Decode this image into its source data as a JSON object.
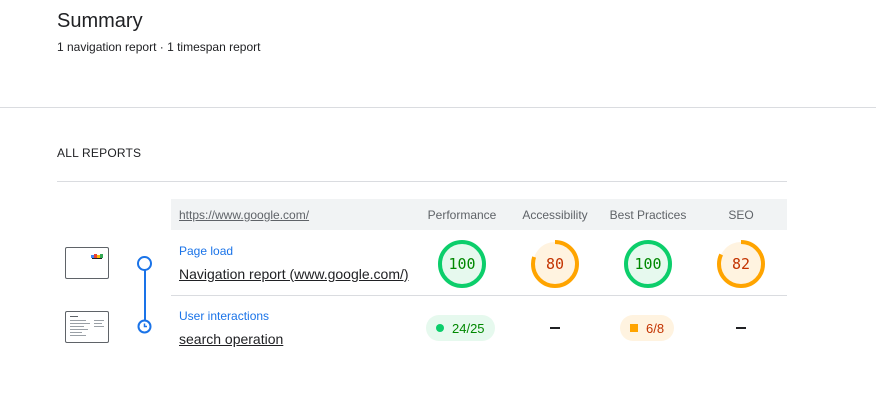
{
  "summary": {
    "title": "Summary",
    "subtitle": "1 navigation report · 1 timespan report"
  },
  "section": {
    "title": "ALL REPORTS"
  },
  "table": {
    "url": "https://www.google.com/",
    "columns": [
      "Performance",
      "Accessibility",
      "Best Practices",
      "SEO"
    ]
  },
  "rows": [
    {
      "type": "Page load",
      "name": "Navigation report (www.google.com/)",
      "scores": [
        {
          "value": "100",
          "status": "pass"
        },
        {
          "value": "80",
          "status": "average"
        },
        {
          "value": "100",
          "status": "pass"
        },
        {
          "value": "82",
          "status": "average"
        }
      ]
    },
    {
      "type": "User interactions",
      "name": "search operation",
      "fractions": [
        {
          "value": "24/25",
          "status": "pass"
        },
        {
          "value": "",
          "status": "none"
        },
        {
          "value": "6/8",
          "status": "average"
        },
        {
          "value": "",
          "status": "none"
        }
      ]
    }
  ],
  "colors": {
    "pass": "#0cce6b",
    "pass_text": "#008800",
    "pass_bg": "#e6f9ee",
    "average": "#ffa400",
    "average_text": "#c33300",
    "average_bg": "#fff3e0",
    "accent": "#1a73e8"
  }
}
